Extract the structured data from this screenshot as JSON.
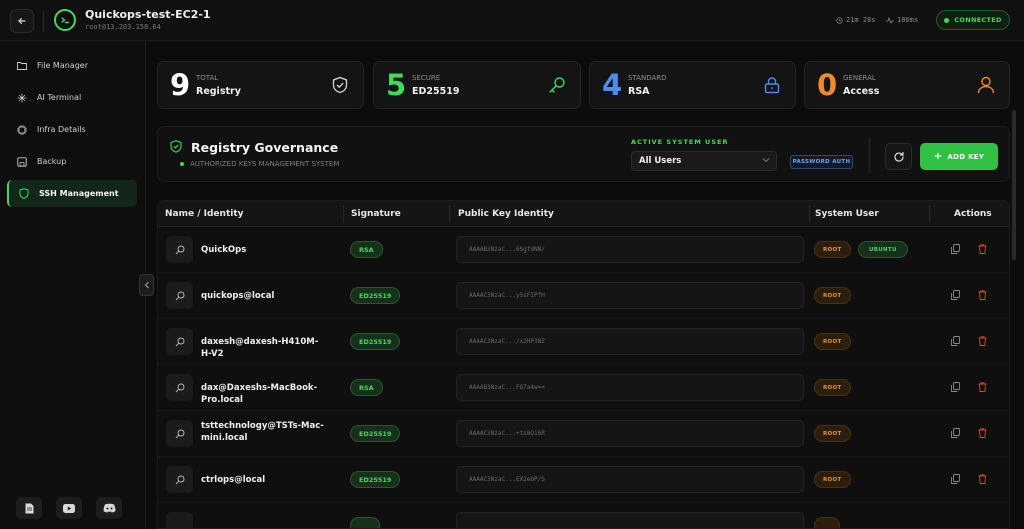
{
  "header": {
    "title": "Quickops-test-EC2-1",
    "subtitle": "root@13.203.158.64",
    "uptime": "21m 28s",
    "latency": "186ms",
    "status": "CONNECTED"
  },
  "sidebar": {
    "items": [
      {
        "label": "File Manager",
        "icon": "folder-icon"
      },
      {
        "label": "AI Terminal",
        "icon": "sparkle-icon"
      },
      {
        "label": "Infra Details",
        "icon": "cpu-icon"
      },
      {
        "label": "Backup",
        "icon": "save-icon"
      },
      {
        "label": "SSH Management",
        "icon": "shield-icon"
      }
    ],
    "active": "SSH Management",
    "footer_icons": [
      "document-icon",
      "youtube-icon",
      "discord-icon"
    ]
  },
  "stats": [
    {
      "number": "9",
      "label": "TOTAL",
      "value": "Registry",
      "color": "#ffffff",
      "icon": "shield-check-icon"
    },
    {
      "number": "5",
      "label": "SECURE",
      "value": "ED25519",
      "color": "#3ddc59",
      "icon": "key-icon"
    },
    {
      "number": "4",
      "label": "STANDARD",
      "value": "RSA",
      "color": "#4c8ef0",
      "icon": "lock-icon"
    },
    {
      "number": "0",
      "label": "GENERAL",
      "value": "Access",
      "color": "#f08a24",
      "icon": "user-icon"
    }
  ],
  "governance": {
    "title": "Registry Governance",
    "subtitle": "AUTHORIZED KEYS MANAGEMENT SYSTEM",
    "active_user_label": "ACTIVE SYSTEM USER",
    "active_user_value": "All Users",
    "auth_badge": "PASSWORD AUTH",
    "add_key_label": "ADD KEY"
  },
  "table": {
    "columns": [
      "Name / Identity",
      "Signature",
      "Public Key Identity",
      "System User",
      "Actions"
    ],
    "rows": [
      {
        "name": "QuickOps",
        "sig": "RSA",
        "key": "AAAAB3NzaC...6SgfdNN/",
        "users": [
          "ROOT",
          "UBUNTU"
        ]
      },
      {
        "name": "quickops@local",
        "sig": "ED25519",
        "key": "AAAAC3NzaC...y5sFIPfH",
        "users": [
          "ROOT"
        ]
      },
      {
        "name": "daxesh@daxesh-H410M-H-V2",
        "sig": "ED25519",
        "key": "AAAAC3NzaC.../x2HP3NZ",
        "users": [
          "ROOT"
        ]
      },
      {
        "name": "dax@Daxeshs-MacBook-Pro.local",
        "sig": "RSA",
        "key": "AAAAB3NzaC...FQ7a4w==",
        "users": [
          "ROOT"
        ]
      },
      {
        "name": "tsttechnology@TSTs-Mac-mini.local",
        "sig": "ED25519",
        "key": "AAAAC3NzaC...+ts8O16R",
        "users": [
          "ROOT"
        ]
      },
      {
        "name": "ctrlops@local",
        "sig": "ED25519",
        "key": "AAAAC3NzaC...EX2ebP/S",
        "users": [
          "ROOT"
        ]
      }
    ]
  },
  "colors": {
    "accent": "#3ddc59",
    "root_badge": "#e6952d",
    "delete": "#d94a3a"
  }
}
